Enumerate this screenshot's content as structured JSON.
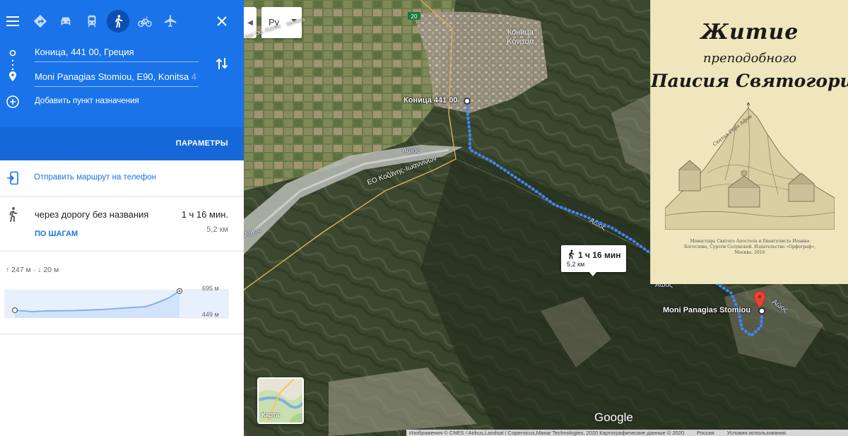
{
  "panel": {
    "modes": [
      {
        "name": "directions-icon"
      },
      {
        "name": "car-icon"
      },
      {
        "name": "transit-icon"
      },
      {
        "name": "walk-icon",
        "active": true
      },
      {
        "name": "bicycle-icon"
      },
      {
        "name": "flight-icon"
      }
    ],
    "origin": "Коница, 441 00, Греция",
    "destination": "Moni Panagias Stomiou, E90, Konitsa",
    "destination_fade": " 4",
    "add_destination": "Добавить пункт назначения",
    "params_label": "ПАРАМЕТРЫ",
    "send_to_phone": "Отправить маршрут на телефон",
    "route": {
      "via": "через дорогу без названия",
      "time": "1 ч 16 мин.",
      "distance": "5,2 км",
      "steps_link": "ПО ШАГАМ"
    },
    "elevation": {
      "gain": "247 м",
      "loss": "20 м",
      "max": "695 м",
      "min": "449 м"
    }
  },
  "map": {
    "layer_value": "Ру",
    "highway_shield": "20",
    "town_name_ru": "Коница",
    "town_name_gr": "Κόνιτσα",
    "origin_label": "Коница 441 00",
    "destination_label": "Moni Panagias Stomiou",
    "river_labels": [
      "Αώος",
      "Αώος",
      "Αώος",
      "Αώος",
      "Αώος"
    ],
    "road_label": "ΕΟ Κοζάνης-Ιωαννίνων",
    "road_label_small": "opetras",
    "road_label_small2": "tsar Od. Konits",
    "bubble_time": "1 ч 16 мин",
    "bubble_distance": "5,2 км",
    "thumb_label": "Карта",
    "google": "Google",
    "attribution": "Изображения © CNES / Airbus,Landsat / Copernicus,Maxar Technologies, 2020 Картографические данные ©  2020",
    "attribution_country": "Россия",
    "attribution_terms": "Условия использования"
  },
  "book": {
    "title_1": "Житие",
    "title_2": "преподобного",
    "title_3": "Паисия Святогорца",
    "art_caption": "Святая Гора Афон",
    "publisher": "Монастырь Святого Апостола и Евангелиста Иоанна Богослова, Суроти Солунской. Издательство «Орфограф», Москва. 2016"
  },
  "colors": {
    "accent": "#1a73e8",
    "route": "#4285f4",
    "destination_pin": "#ea4335"
  }
}
